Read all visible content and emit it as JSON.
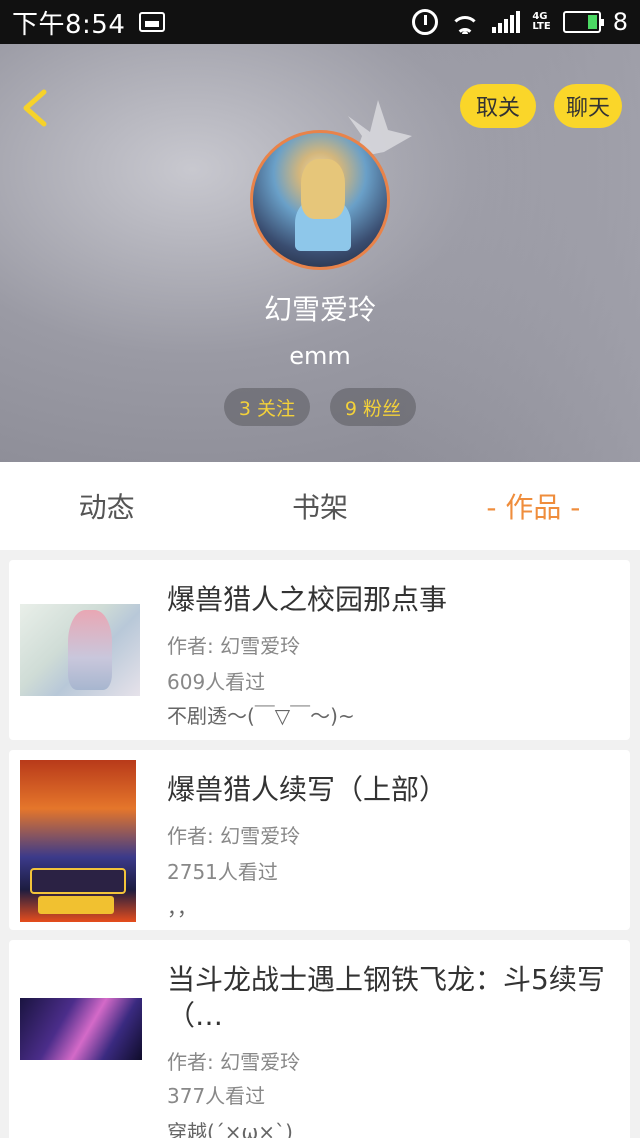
{
  "status_bar": {
    "time": "下午8:54",
    "network": "4G LTE",
    "battery": "8"
  },
  "profile": {
    "back_icon": "chevron-left-icon",
    "unfollow_label": "取关",
    "chat_label": "聊天",
    "username": "幻雪爱玲",
    "signature": "emm",
    "follow_count_label": "3 关注",
    "fans_count_label": "9 粉丝"
  },
  "tabs": [
    {
      "label": "动态"
    },
    {
      "label": "书架"
    },
    {
      "label": "- 作品 -"
    }
  ],
  "works": [
    {
      "title": "爆兽猎人之校园那点事",
      "author": "作者: 幻雪爱玲",
      "views": "609人看过",
      "description": "不剧透～(￣▽￣～)~"
    },
    {
      "title": "爆兽猎人续写（上部）",
      "author": "作者: 幻雪爱玲",
      "views": "2751人看过",
      "description": "，，"
    },
    {
      "title": "当斗龙战士遇上钢铁飞龙：斗5续写（…",
      "author": "作者: 幻雪爱玲",
      "views": "377人看过",
      "description": "穿越(´×ω×`)"
    }
  ],
  "colors": {
    "accent_yellow": "#fad629",
    "tab_active": "#ef8d3c",
    "stat_text": "#f3d13a",
    "avatar_border": "#e8834a"
  }
}
